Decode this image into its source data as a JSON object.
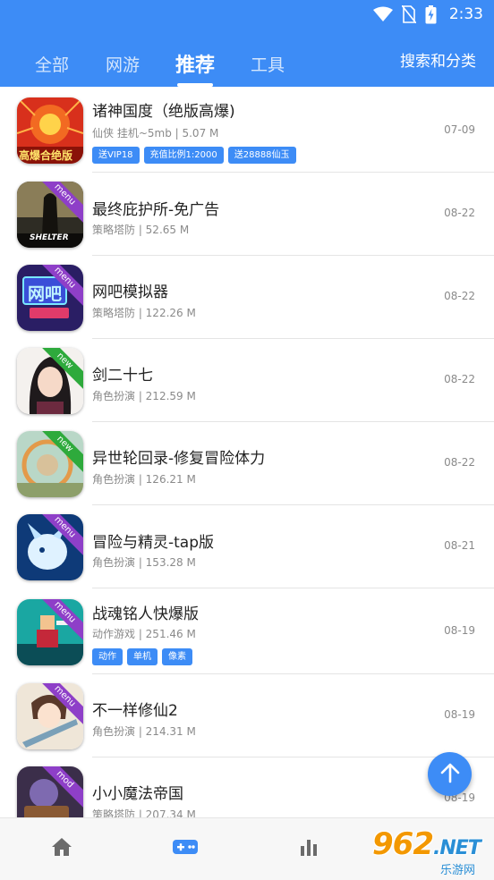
{
  "status_bar": {
    "time": "2:33"
  },
  "tabs": [
    {
      "label": "全部"
    },
    {
      "label": "网游"
    },
    {
      "label": "推荐"
    },
    {
      "label": "工具"
    }
  ],
  "header": {
    "search_label": "搜索和分类",
    "active_tab": "推荐"
  },
  "apps": [
    {
      "name": "诸神国度（绝版高爆)",
      "meta": "仙侠 挂机~5mb | 5.07 M",
      "date": "07-09",
      "tags": [
        "送VIP18",
        "充值比例1:2000",
        "送28888仙玉"
      ],
      "badge": "",
      "icon_text": "高爆合绝版"
    },
    {
      "name": "最终庇护所-免广告",
      "meta": "策略塔防 | 52.65 M",
      "date": "08-22",
      "tags": [],
      "badge": "menu",
      "icon_text": "SHELTER"
    },
    {
      "name": "网吧模拟器",
      "meta": "策略塔防 | 122.26 M",
      "date": "08-22",
      "tags": [],
      "badge": "menu",
      "icon_text": "网吧"
    },
    {
      "name": "剑二十七",
      "meta": "角色扮演 | 212.59 M",
      "date": "08-22",
      "tags": [],
      "badge": "new",
      "icon_text": ""
    },
    {
      "name": "异世轮回录-修复冒险体力",
      "meta": "角色扮演 | 126.21 M",
      "date": "08-22",
      "tags": [],
      "badge": "new",
      "icon_text": ""
    },
    {
      "name": "冒险与精灵-tap版",
      "meta": "角色扮演 | 153.28 M",
      "date": "08-21",
      "tags": [],
      "badge": "menu",
      "icon_text": ""
    },
    {
      "name": "战魂铭人快爆版",
      "meta": "动作游戏 | 251.46 M",
      "date": "08-19",
      "tags": [
        "动作",
        "单机",
        "像素"
      ],
      "badge": "menu",
      "icon_text": ""
    },
    {
      "name": "不一样修仙2",
      "meta": "角色扮演 | 214.31 M",
      "date": "08-19",
      "tags": [],
      "badge": "menu",
      "icon_text": ""
    },
    {
      "name": "小小魔法帝国",
      "meta": "策略塔防 | 207.34 M",
      "date": "08-19",
      "tags": [],
      "badge": "mod",
      "icon_text": ""
    }
  ],
  "badge_colors": {
    "menu": "#8e3fc8",
    "new": "#2eaa3c",
    "mod": "#8e3fc8"
  },
  "accent_color": "#3d8cf6",
  "bottom_nav": [
    {
      "icon": "home-icon"
    },
    {
      "icon": "gamepad-icon"
    },
    {
      "icon": "bar-chart-icon"
    }
  ],
  "watermark": {
    "main": "962",
    "net": ".NET",
    "sub": "乐游网"
  }
}
